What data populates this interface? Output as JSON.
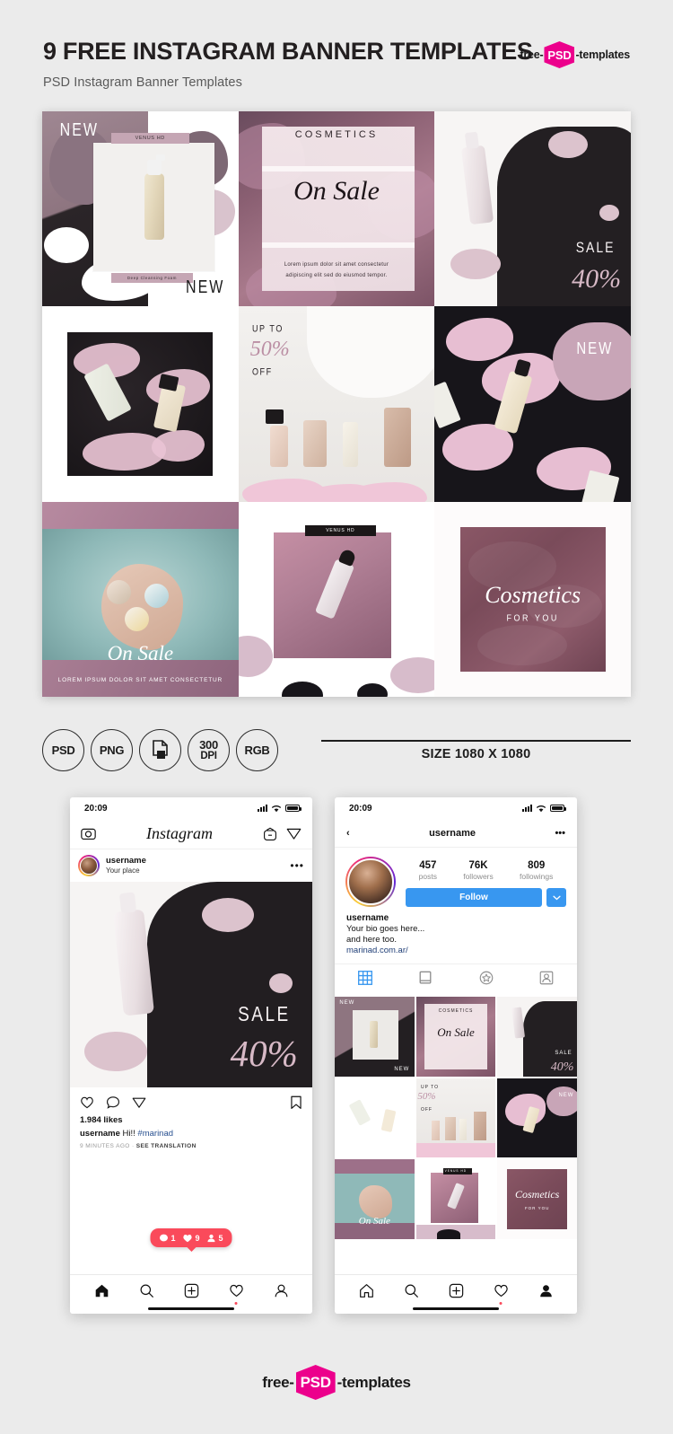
{
  "header": {
    "title": "9 FREE INSTAGRAM BANNER TEMPLATES",
    "subtitle": "PSD Instagram Banner Templates",
    "logo": {
      "pre": "free-",
      "mid": "PSD",
      "post": "-templates"
    }
  },
  "banners": [
    {
      "id": "banner-new-venus-hd",
      "new_top": "NEW",
      "chip_top": "VENUS HD",
      "chip_bottom": "Deep Cleansing Foam",
      "new_bottom": "NEW"
    },
    {
      "id": "banner-cosmetics-on-sale",
      "title": "COSMETICS",
      "script": "On Sale",
      "body_line1": "Lorem ipsum dolor sit amet  consectetur",
      "body_line2": "adipiscing elit  sed do eiusmod tempor."
    },
    {
      "id": "banner-sale-40",
      "sale": "SALE",
      "percent": "40%"
    },
    {
      "id": "banner-ordinary-duo"
    },
    {
      "id": "banner-up-to-50-off",
      "upto": "UP TO",
      "percent": "50%",
      "off": "OFF"
    },
    {
      "id": "banner-new-splash",
      "new": "NEW"
    },
    {
      "id": "banner-bath-on-sale",
      "script": "On Sale",
      "sub": "LOREM IPSUM DOLOR SIT AMET  CONSECTETUR"
    },
    {
      "id": "banner-venus-hd-water",
      "chip": "VENUS HD"
    },
    {
      "id": "banner-cosmetics-for-you",
      "script": "Cosmetics",
      "sub": "FOR YOU"
    }
  ],
  "badges": [
    {
      "name": "psd-badge",
      "line1": "PSD",
      "line2": ""
    },
    {
      "name": "png-badge",
      "line1": "PNG",
      "line2": ""
    },
    {
      "name": "layers-badge",
      "line1": "",
      "line2": ""
    },
    {
      "name": "dpi-badge",
      "line1": "300",
      "line2": "DPI"
    },
    {
      "name": "rgb-badge",
      "line1": "RGB",
      "line2": ""
    }
  ],
  "size_note": "SIZE 1080 X 1080",
  "phone_feed": {
    "status": {
      "time": "20:09"
    },
    "nav": {
      "logo": "Instagram"
    },
    "post": {
      "username": "username",
      "place": "Your place",
      "menu": "•••",
      "image": {
        "sale": "SALE",
        "percent": "40%"
      },
      "likes": "1.984 likes",
      "caption_user": "username",
      "caption_text": " Hi!! ",
      "caption_tag": "#marinad",
      "time_ago": "9 MINUTES AGO",
      "separator": " · ",
      "see_translation": "SEE TRANSLATION"
    },
    "notification": {
      "comments": "1",
      "likes": "9",
      "follows": "5"
    },
    "tabs": [
      "home-icon",
      "search-icon",
      "add-post-icon",
      "heart-icon",
      "profile-icon"
    ]
  },
  "phone_profile": {
    "status": {
      "time": "20:09"
    },
    "nav": {
      "title": "username",
      "back": "‹",
      "menu": "•••"
    },
    "stats": [
      {
        "value": "457",
        "label": "posts"
      },
      {
        "value": "76K",
        "label": "followers"
      },
      {
        "value": "809",
        "label": "followings"
      }
    ],
    "follow_button": "Follow",
    "bio": {
      "name": "username",
      "line1": "Your bio goes here...",
      "line2": "and here too.",
      "link": "marinad.com.ar/"
    },
    "tabs": [
      "grid-icon",
      "list-icon",
      "star-icon",
      "tagged-icon"
    ],
    "grid_labels": {
      "cell1_new_top": "NEW",
      "cell1_new_bottom": "NEW",
      "cell2_title": "COSMETICS",
      "cell2_script": "On Sale",
      "cell3_sale": "SALE",
      "cell3_pct": "40%",
      "cell5_upto": "UP TO",
      "cell5_pct": "50%",
      "cell5_off": "OFF",
      "cell6_new": "NEW",
      "cell7_script": "On Sale",
      "cell8_chip": "VENUS HD",
      "cell9_script": "Cosmetics",
      "cell9_sub": "FOR YOU"
    },
    "nav_tabs": [
      "home-icon",
      "search-icon",
      "add-post-icon",
      "heart-icon",
      "profile-icon"
    ]
  },
  "footer": {
    "logo": {
      "pre": "free-",
      "mid": "PSD",
      "post": "-templates"
    }
  },
  "colors": {
    "page_bg": "#ebebeb",
    "accent_pink": "#ec008c",
    "ig_blue": "#3897f0",
    "notif_red": "#fa4a5b",
    "link_blue": "#274f8f",
    "mauve": "#b07f95",
    "dark": "#221e21"
  }
}
